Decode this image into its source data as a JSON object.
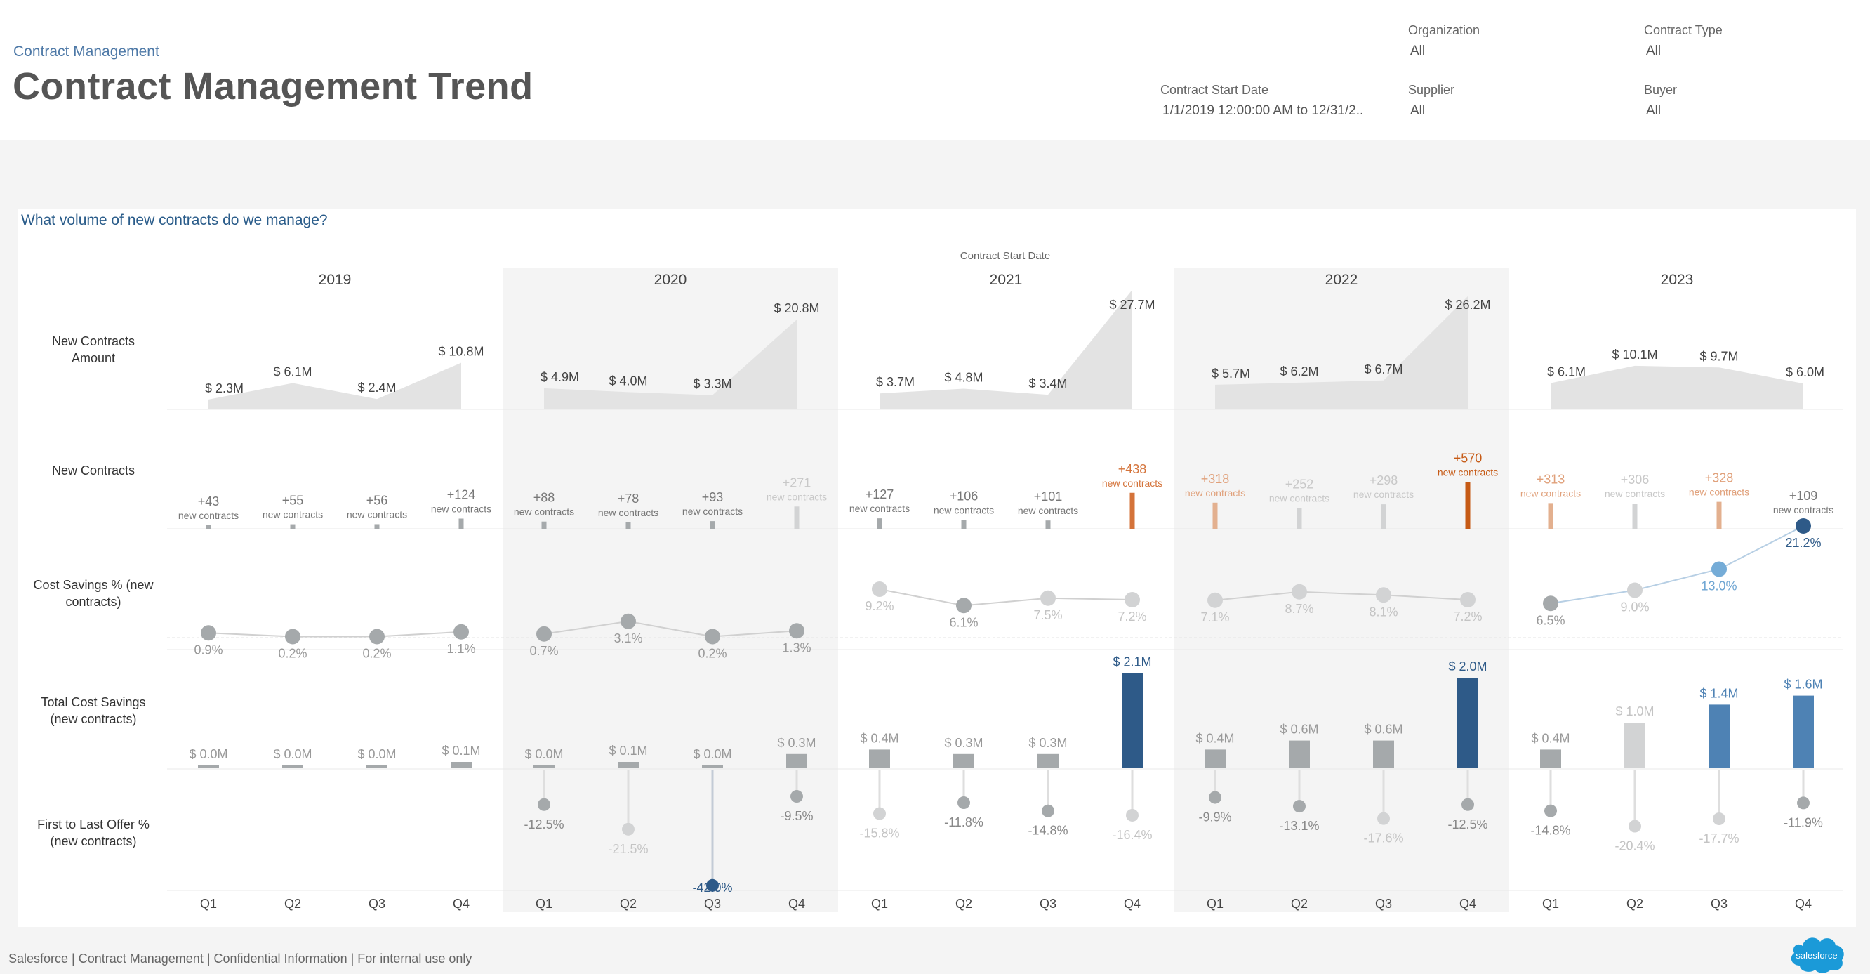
{
  "header": {
    "breadcrumb": "Contract Management",
    "title": "Contract Management Trend"
  },
  "filters": {
    "organization": {
      "label": "Organization",
      "value": "All"
    },
    "contract_type": {
      "label": "Contract Type",
      "value": "All"
    },
    "contract_start_date": {
      "label": "Contract Start Date",
      "value": "1/1/2019 12:00:00 AM to 12/31/2.."
    },
    "supplier": {
      "label": "Supplier",
      "value": "All"
    },
    "buyer": {
      "label": "Buyer",
      "value": "All"
    }
  },
  "question": "What volume of new contracts do we manage?",
  "footer": "Salesforce | Contract Management | Confidential Information | For internal use only",
  "logo_text": "salesforce",
  "colors": {
    "grey": "#a5a9ab",
    "light_grey": "#d2d3d4",
    "orange": "#d4733a",
    "dark_orange": "#c65a15",
    "light_orange": "#e3b08f",
    "blue_dark": "#2e5a88",
    "blue_mid": "#4e82b4",
    "blue_light": "#75acd7",
    "year_band": "#f4f4f4"
  },
  "chart_data": {
    "type": "table",
    "column_header_title": "Contract Start Date",
    "years": [
      "2019",
      "2020",
      "2021",
      "2022",
      "2023"
    ],
    "quarters": [
      "Q1",
      "Q2",
      "Q3",
      "Q4"
    ],
    "row_labels": [
      [
        "New Contracts",
        "Amount"
      ],
      [
        "New Contracts"
      ],
      [
        "Cost Savings % (new",
        "contracts)"
      ],
      [
        "Total Cost Savings",
        "(new contracts)"
      ],
      [
        "First to Last Offer %",
        "(new contracts)"
      ]
    ],
    "new_contracts_amount": {
      "type": "area",
      "unit": "$M",
      "values": [
        2.3,
        6.1,
        2.4,
        10.8,
        4.9,
        4.0,
        3.3,
        20.8,
        3.7,
        4.8,
        3.4,
        27.7,
        5.7,
        6.2,
        6.7,
        26.2,
        6.1,
        10.1,
        9.7,
        6.0
      ],
      "labels": [
        "$ 2.3M",
        "$ 6.1M",
        "$ 2.4M",
        "$ 10.8M",
        "$ 4.9M",
        "$ 4.0M",
        "$ 3.3M",
        "$ 20.8M",
        "$ 3.7M",
        "$ 4.8M",
        "$ 3.4M",
        "$ 27.7M",
        "$ 5.7M",
        "$ 6.2M",
        "$ 6.7M",
        "$ 26.2M",
        "$ 6.1M",
        "$ 10.1M",
        "$ 9.7M",
        "$ 6.0M"
      ]
    },
    "new_contracts": {
      "type": "bar",
      "values": [
        43,
        55,
        56,
        124,
        88,
        78,
        93,
        271,
        127,
        106,
        101,
        438,
        318,
        252,
        298,
        570,
        313,
        306,
        328,
        109
      ],
      "labels": [
        "+43",
        "+55",
        "+56",
        "+124",
        "+88",
        "+78",
        "+93",
        "+271",
        "+127",
        "+106",
        "+101",
        "+438",
        "+318",
        "+252",
        "+298",
        "+570",
        "+313",
        "+306",
        "+328",
        "+109"
      ],
      "sublabel": "new contracts",
      "color_keys": [
        "grey",
        "grey",
        "grey",
        "grey",
        "grey",
        "grey",
        "grey",
        "light_grey",
        "grey",
        "grey",
        "grey",
        "orange",
        "light_orange",
        "light_grey",
        "light_grey",
        "dark_orange",
        "light_orange",
        "light_grey",
        "light_orange",
        "grey"
      ]
    },
    "cost_savings_pct": {
      "type": "line",
      "unit": "%",
      "values": [
        0.9,
        0.2,
        0.2,
        1.1,
        0.7,
        3.1,
        0.2,
        1.3,
        9.2,
        6.1,
        7.5,
        7.2,
        7.1,
        8.7,
        8.1,
        7.2,
        6.5,
        9.0,
        13.0,
        21.2
      ],
      "labels": [
        "0.9%",
        "0.2%",
        "0.2%",
        "1.1%",
        "0.7%",
        "3.1%",
        "0.2%",
        "1.3%",
        "9.2%",
        "6.1%",
        "7.5%",
        "7.2%",
        "7.1%",
        "8.7%",
        "8.1%",
        "7.2%",
        "6.5%",
        "9.0%",
        "13.0%",
        "21.2%"
      ],
      "color_keys": [
        "grey",
        "grey",
        "grey",
        "grey",
        "grey",
        "grey",
        "grey",
        "grey",
        "light_grey",
        "grey",
        "light_grey",
        "light_grey",
        "light_grey",
        "light_grey",
        "light_grey",
        "light_grey",
        "grey",
        "light_grey",
        "blue_light",
        "blue_dark"
      ]
    },
    "total_cost_savings": {
      "type": "bar",
      "unit": "$M",
      "values": [
        0.0,
        0.0,
        0.0,
        0.1,
        0.0,
        0.1,
        0.0,
        0.3,
        0.4,
        0.3,
        0.3,
        2.1,
        0.4,
        0.6,
        0.6,
        2.0,
        0.4,
        1.0,
        1.4,
        1.6
      ],
      "labels": [
        "$ 0.0M",
        "$ 0.0M",
        "$ 0.0M",
        "$ 0.1M",
        "$ 0.0M",
        "$ 0.1M",
        "$ 0.0M",
        "$ 0.3M",
        "$ 0.4M",
        "$ 0.3M",
        "$ 0.3M",
        "$ 2.1M",
        "$ 0.4M",
        "$ 0.6M",
        "$ 0.6M",
        "$ 2.0M",
        "$ 0.4M",
        "$ 1.0M",
        "$ 1.4M",
        "$ 1.6M"
      ],
      "color_keys": [
        "grey",
        "grey",
        "grey",
        "grey",
        "grey",
        "grey",
        "grey",
        "grey",
        "grey",
        "grey",
        "grey",
        "blue_dark",
        "grey",
        "grey",
        "grey",
        "blue_dark",
        "grey",
        "light_grey",
        "blue_mid",
        "blue_mid"
      ]
    },
    "first_to_last_offer_pct": {
      "type": "lollipop",
      "unit": "%",
      "values": [
        null,
        null,
        null,
        null,
        -12.5,
        -21.5,
        -42.0,
        -9.5,
        -15.8,
        -11.8,
        -14.8,
        -16.4,
        -9.9,
        -13.1,
        -17.6,
        -12.5,
        -14.8,
        -20.4,
        -17.7,
        -11.9
      ],
      "labels": [
        "",
        "",
        "",
        "",
        "-12.5%",
        "-21.5%",
        "-42.0%",
        "-9.5%",
        "-15.8%",
        "-11.8%",
        "-14.8%",
        "-16.4%",
        "-9.9%",
        "-13.1%",
        "-17.6%",
        "-12.5%",
        "-14.8%",
        "-20.4%",
        "-17.7%",
        "-11.9%"
      ],
      "color_keys": [
        "grey",
        "grey",
        "grey",
        "grey",
        "grey",
        "light_grey",
        "blue_dark",
        "grey",
        "light_grey",
        "grey",
        "grey",
        "light_grey",
        "grey",
        "grey",
        "light_grey",
        "grey",
        "grey",
        "light_grey",
        "light_grey",
        "grey"
      ]
    }
  }
}
